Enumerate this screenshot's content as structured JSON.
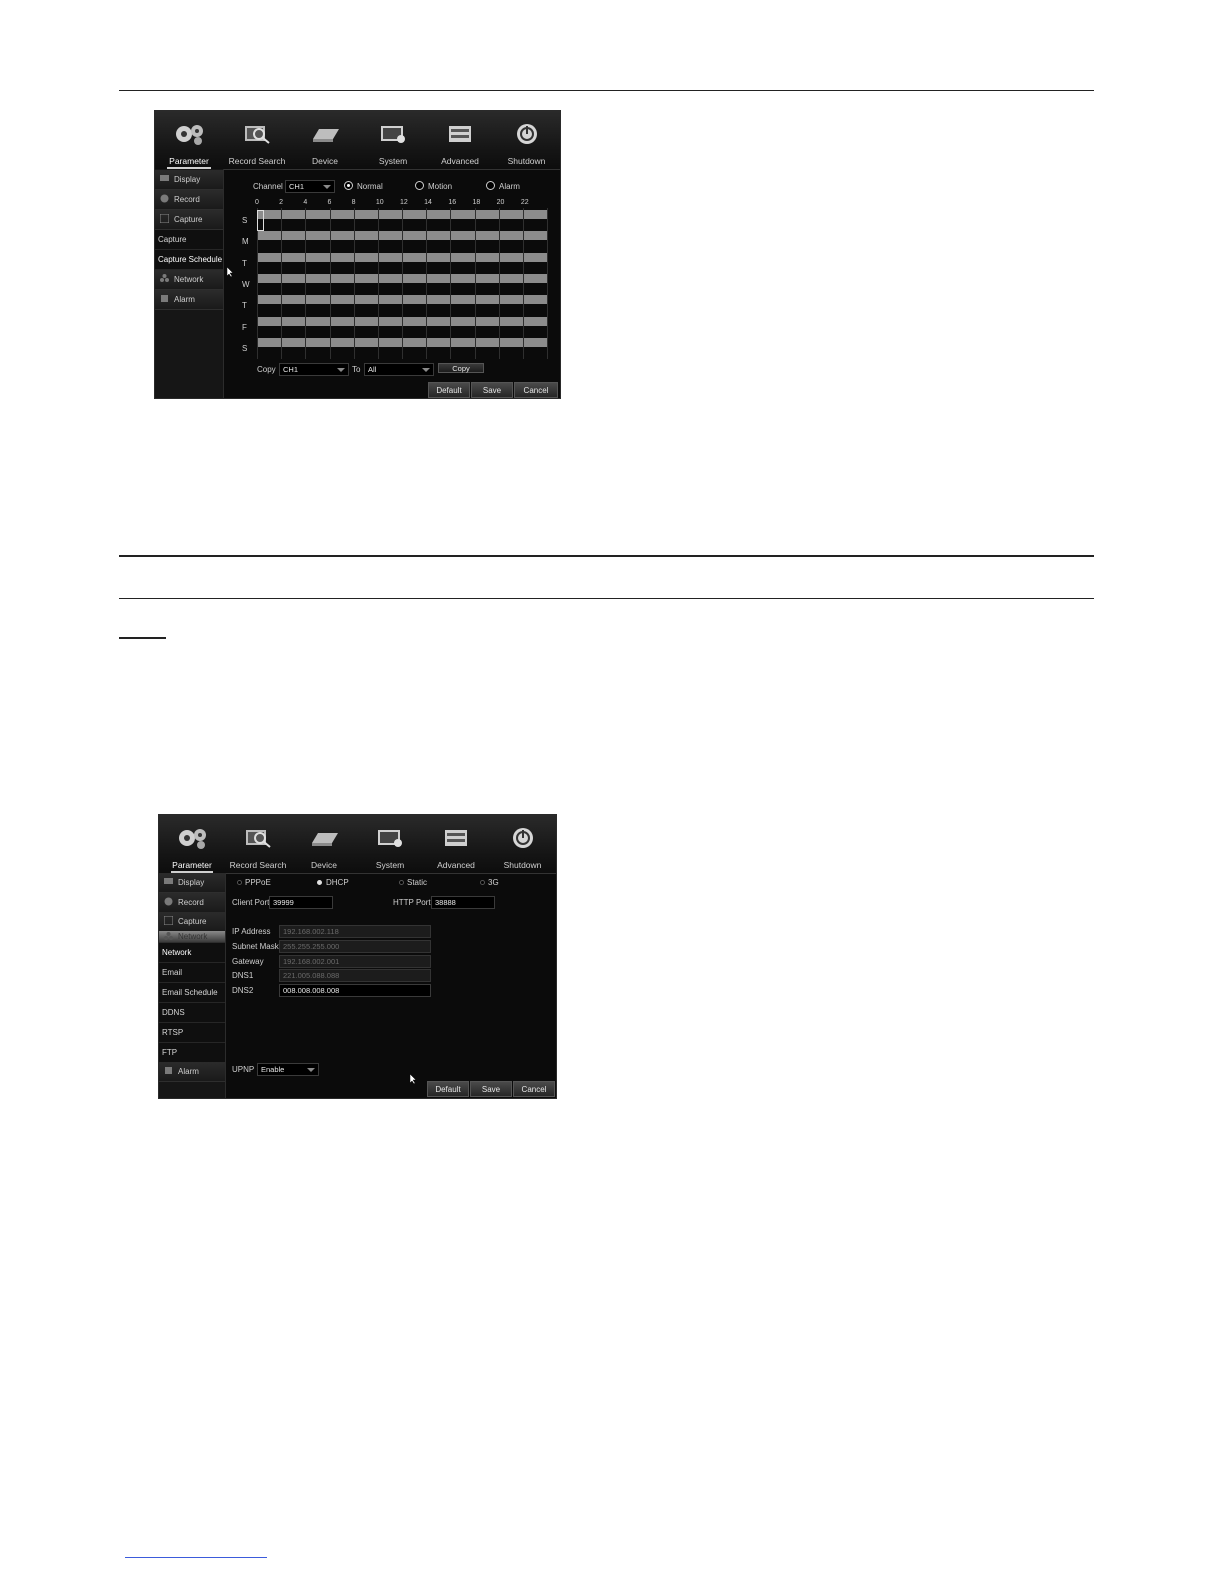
{
  "top_menu": [
    {
      "label": "Parameter",
      "icon": "gears-icon",
      "active": true
    },
    {
      "label": "Record Search",
      "icon": "record-search-icon"
    },
    {
      "label": "Device",
      "icon": "device-icon"
    },
    {
      "label": "System",
      "icon": "system-icon"
    },
    {
      "label": "Advanced",
      "icon": "advanced-icon"
    },
    {
      "label": "Shutdown",
      "icon": "power-icon"
    }
  ],
  "screen1": {
    "sidebar": {
      "display": "Display",
      "record": "Record",
      "capture": "Capture",
      "capture_sub": "Capture",
      "capture_schedule": "Capture Schedule",
      "network": "Network",
      "alarm": "Alarm"
    },
    "channel_label": "Channel",
    "channel_value": "CH1",
    "mode_options": [
      "Normal",
      "Motion",
      "Alarm"
    ],
    "selected_mode": "Normal",
    "hours": [
      "0",
      "2",
      "4",
      "6",
      "8",
      "10",
      "12",
      "14",
      "16",
      "18",
      "20",
      "22"
    ],
    "days": [
      "S",
      "M",
      "T",
      "W",
      "T",
      "F",
      "S"
    ],
    "copy_label": "Copy",
    "copy_from": "CH1",
    "to_label": "To",
    "copy_to": "All",
    "copy_button": "Copy",
    "buttons": {
      "default": "Default",
      "save": "Save",
      "cancel": "Cancel"
    }
  },
  "screen2": {
    "sidebar": {
      "display": "Display",
      "record": "Record",
      "capture": "Capture",
      "network": "Network",
      "network_sub": "Network",
      "email": "Email",
      "email_schedule": "Email Schedule",
      "ddns": "DDNS",
      "rtsp": "RTSP",
      "ftp": "FTP",
      "alarm": "Alarm"
    },
    "connection_types": [
      "PPPoE",
      "DHCP",
      "Static",
      "3G"
    ],
    "selected_type": "DHCP",
    "client_port_label": "Client Port",
    "client_port": "39999",
    "http_port_label": "HTTP Port",
    "http_port": "38888",
    "ip_label": "IP Address",
    "ip_value": "192.168.002.118",
    "subnet_label": "Subnet Mask",
    "subnet_value": "255.255.255.000",
    "gateway_label": "Gateway",
    "gateway_value": "192.168.002.001",
    "dns1_label": "DNS1",
    "dns1_value": "221.005.088.088",
    "dns2_label": "DNS2",
    "dns2_value": "008.008.008.008",
    "upnp_label": "UPNP",
    "upnp_value": "Enable",
    "buttons": {
      "default": "Default",
      "save": "Save",
      "cancel": "Cancel"
    }
  }
}
